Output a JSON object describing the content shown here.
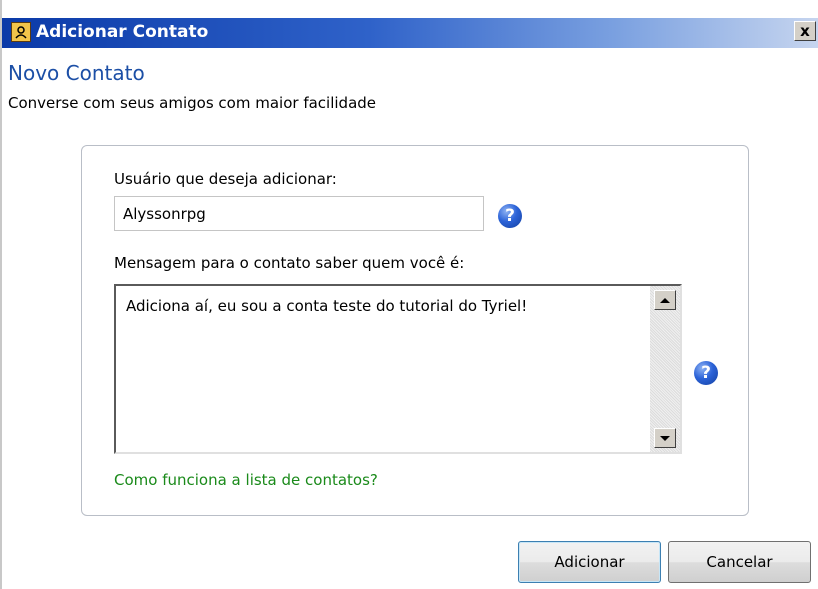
{
  "window": {
    "title": "Adicionar Contato",
    "close_label": "x",
    "app_icon": "contact-app-icon"
  },
  "header": {
    "title": "Novo Contato",
    "subtitle": "Converse com seus amigos com maior facilidade"
  },
  "form": {
    "user_label": "Usuário que deseja adicionar:",
    "user_value": "Alyssonrpg",
    "user_help_icon": "help-icon",
    "message_label": "Mensagem para o contato saber quem você é:",
    "message_value": "Adiciona aí, eu sou a conta teste do tutorial do Tyriel!",
    "message_help_icon": "help-icon",
    "help_link": "Como funciona a lista de contatos?"
  },
  "buttons": {
    "add_label": "Adicionar",
    "cancel_label": "Cancelar"
  },
  "colors": {
    "title_bar_start": "#0b3aa8",
    "heading": "#1c4fa6",
    "link": "#1a8a1a",
    "help_icon": "#2c63d8"
  }
}
